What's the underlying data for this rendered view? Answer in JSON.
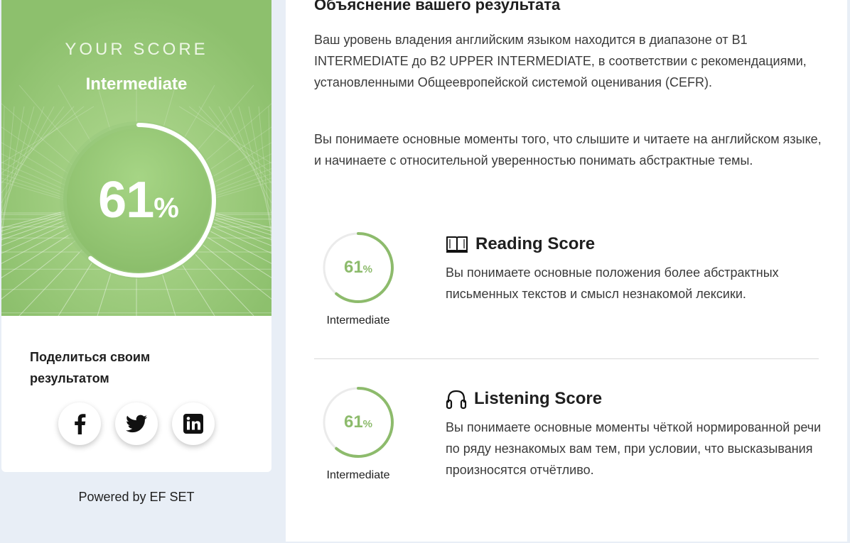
{
  "score_card": {
    "heading": "YOUR SCORE",
    "level": "Intermediate",
    "score_value": "61",
    "score_unit": "%",
    "score_fraction": 0.61
  },
  "share": {
    "title": "Поделиться своим результатом",
    "buttons": [
      {
        "icon": "facebook-icon"
      },
      {
        "icon": "twitter-icon"
      },
      {
        "icon": "linkedin-icon"
      }
    ]
  },
  "powered_by": "Powered by EF SET",
  "explanation": {
    "title": "Объяснение вашего результата",
    "paragraphs": [
      "Ваш уровень владения английским языком находится в диапазоне от B1 INTERMEDIATE до B2 UPPER INTERMEDIATE, в соответствии с рекомендациями, установленными Общеевропейской системой оценивания (CEFR).",
      "Вы понимаете основные моменты того, что слышите и читаете на английском языке, и начинаете с относительной уверенностью понимать абстрактные темы."
    ]
  },
  "skills": [
    {
      "icon": "book-icon",
      "title": "Reading Score",
      "score_value": "61",
      "score_unit": "%",
      "score_fraction": 0.61,
      "level": "Intermediate",
      "description": "Вы понимаете основные положения более абстрактных письменных текстов и смысл незнакомой лексики."
    },
    {
      "icon": "headphones-icon",
      "title": "Listening Score",
      "score_value": "61",
      "score_unit": "%",
      "score_fraction": 0.61,
      "level": "Intermediate",
      "description": "Вы понимаете основные моменты чёткой нормированной речи по ряду незнакомых вам тем, при условии, что высказывания произносятся отчётливо."
    }
  ],
  "colors": {
    "hero_green": "#8dc06d",
    "accent_green": "#8dbb6c",
    "page_background": "#e8eef6"
  }
}
